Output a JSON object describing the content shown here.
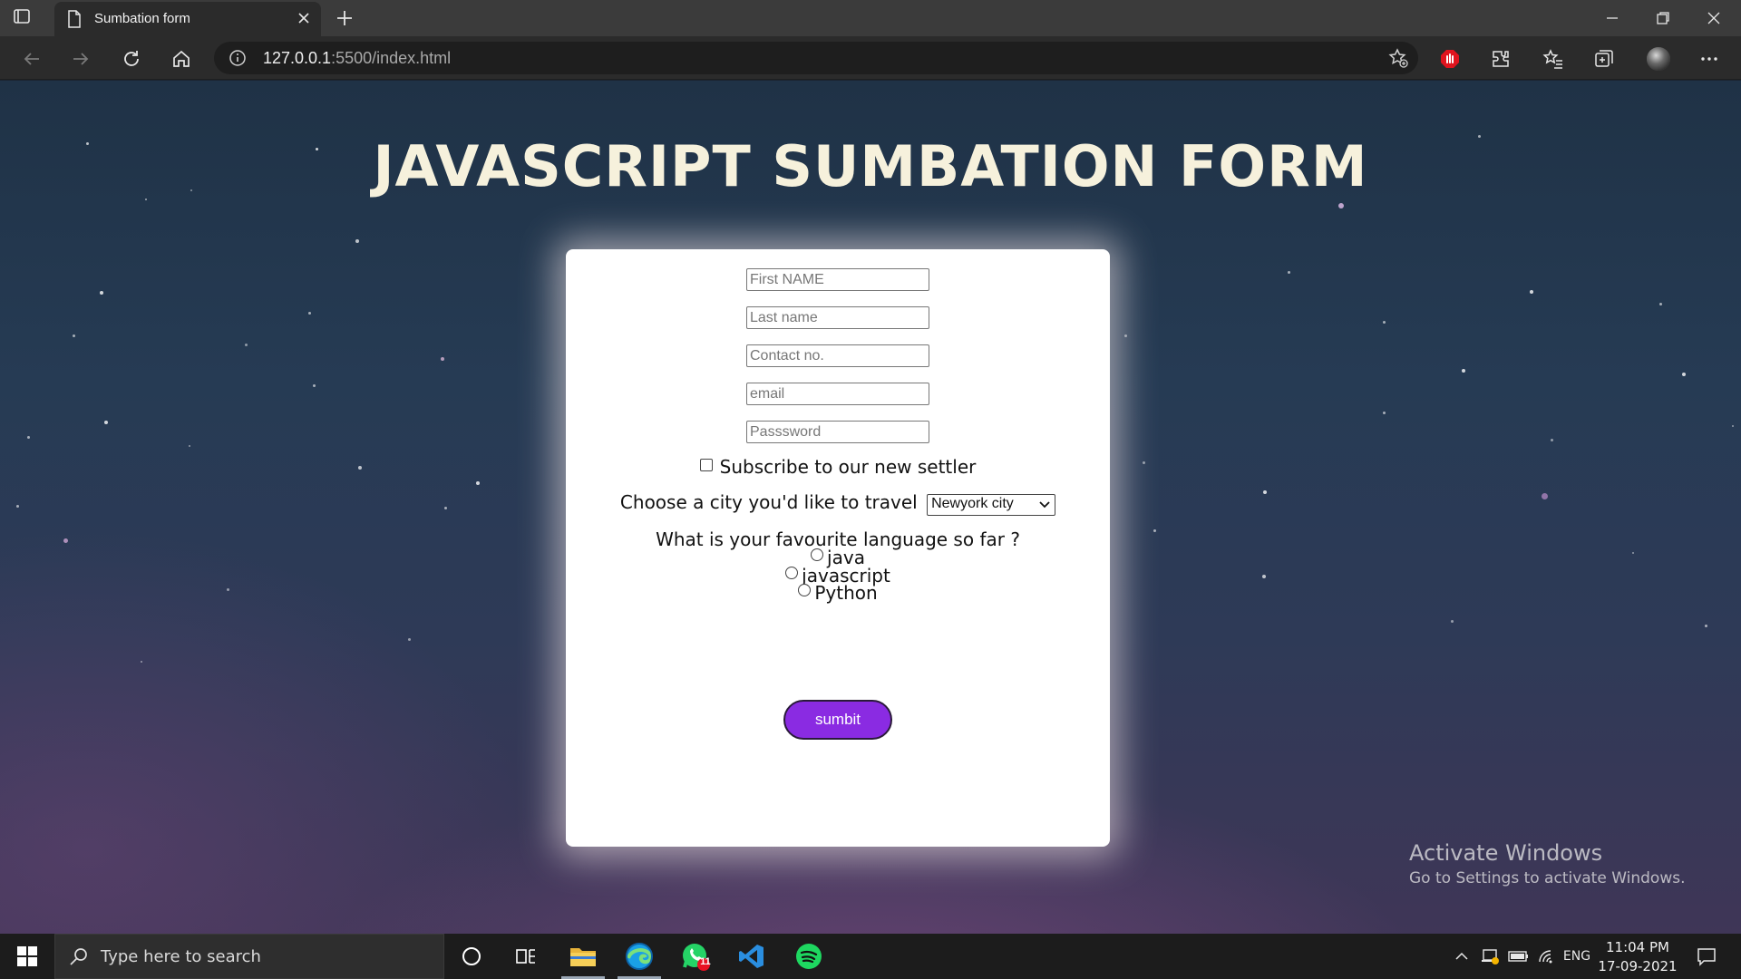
{
  "browser": {
    "tab_title": "Sumbation form",
    "url_host": "127.0.0.1",
    "url_path": ":5500/index.html"
  },
  "page": {
    "heading": "JAVASCRIPT SUMBATION FORM",
    "form": {
      "first_name_placeholder": "First NAME",
      "last_name_placeholder": "Last name",
      "contact_placeholder": "Contact no.",
      "email_placeholder": "email",
      "password_placeholder": "Passsword",
      "subscribe_label": "Subscribe to our new settler",
      "subscribe_checked": false,
      "city_label": "Choose a city you'd like to travel",
      "city_selected": "Newyork city",
      "language_question": "What is your favourite language so far ?",
      "languages": [
        "java",
        "javascript",
        "Python"
      ],
      "submit_label": "sumbit"
    },
    "watermark": {
      "title": "Activate Windows",
      "subtitle": "Go to Settings to activate Windows."
    }
  },
  "taskbar": {
    "search_placeholder": "Type here to search",
    "whatsapp_badge": "11",
    "language": "ENG",
    "time": "11:04 PM",
    "date": "17-09-2021"
  },
  "colors": {
    "submit_button": "#8a2be2",
    "heading": "#f6f1dc",
    "card": "#ffffff"
  }
}
